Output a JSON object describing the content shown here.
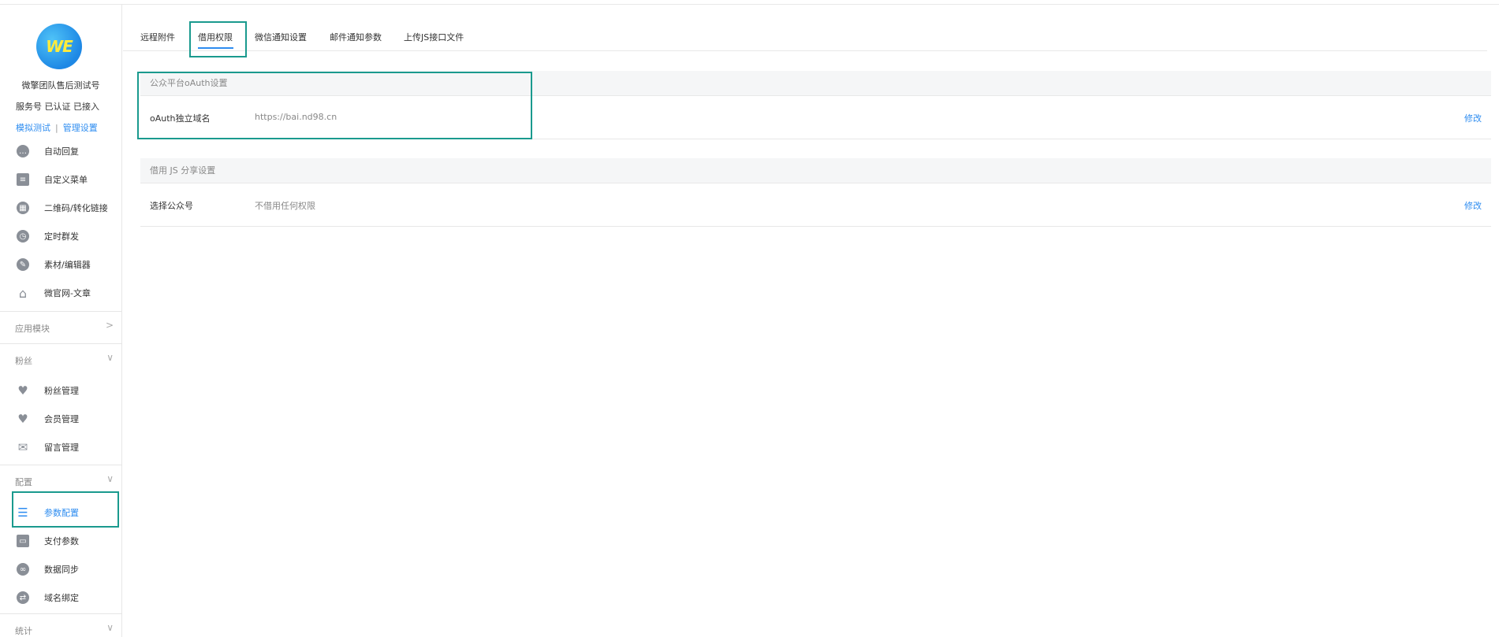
{
  "account": {
    "name": "微擎团队售后测试号",
    "status": "服务号 已认证 已接入",
    "link_test": "模拟测试",
    "link_sep": "|",
    "link_manage": "管理设置"
  },
  "sidebar": {
    "items_top": [
      {
        "label": "自动回复",
        "icon": "chat-icon"
      },
      {
        "label": "自定义菜单",
        "icon": "document-icon"
      },
      {
        "label": "二维码/转化链接",
        "icon": "qrcode-icon"
      },
      {
        "label": "定时群发",
        "icon": "clock-icon"
      },
      {
        "label": "素材/编辑器",
        "icon": "pen-icon"
      },
      {
        "label": "微官网-文章",
        "icon": "home-icon"
      }
    ],
    "section_app": "应用模块",
    "section_fans": "粉丝",
    "fans_items": [
      {
        "label": "粉丝管理",
        "icon": "heart-icon"
      },
      {
        "label": "会员管理",
        "icon": "heart-icon"
      },
      {
        "label": "留言管理",
        "icon": "mail-icon"
      }
    ],
    "section_config": "配置",
    "config_items": [
      {
        "label": "参数配置",
        "icon": "list-icon",
        "active": true
      },
      {
        "label": "支付参数",
        "icon": "card-icon"
      },
      {
        "label": "数据同步",
        "icon": "link-icon"
      },
      {
        "label": "域名绑定",
        "icon": "bind-icon"
      }
    ],
    "section_stats": "统计"
  },
  "tabs": [
    {
      "label": "远程附件"
    },
    {
      "label": "借用权限",
      "active": true
    },
    {
      "label": "微信通知设置"
    },
    {
      "label": "邮件通知参数"
    },
    {
      "label": "上传JS接口文件"
    }
  ],
  "panels": {
    "oauth": {
      "title": "公众平台oAuth设置",
      "key": "oAuth独立域名",
      "value": "https://bai.nd98.cn",
      "edit": "修改"
    },
    "js_share": {
      "title": "借用 JS 分享设置",
      "key": "选择公众号",
      "value": "不借用任何权限",
      "edit": "修改"
    }
  },
  "colors": {
    "accent": "#2d8cf0",
    "highlight_box": "#1a9a8e"
  }
}
